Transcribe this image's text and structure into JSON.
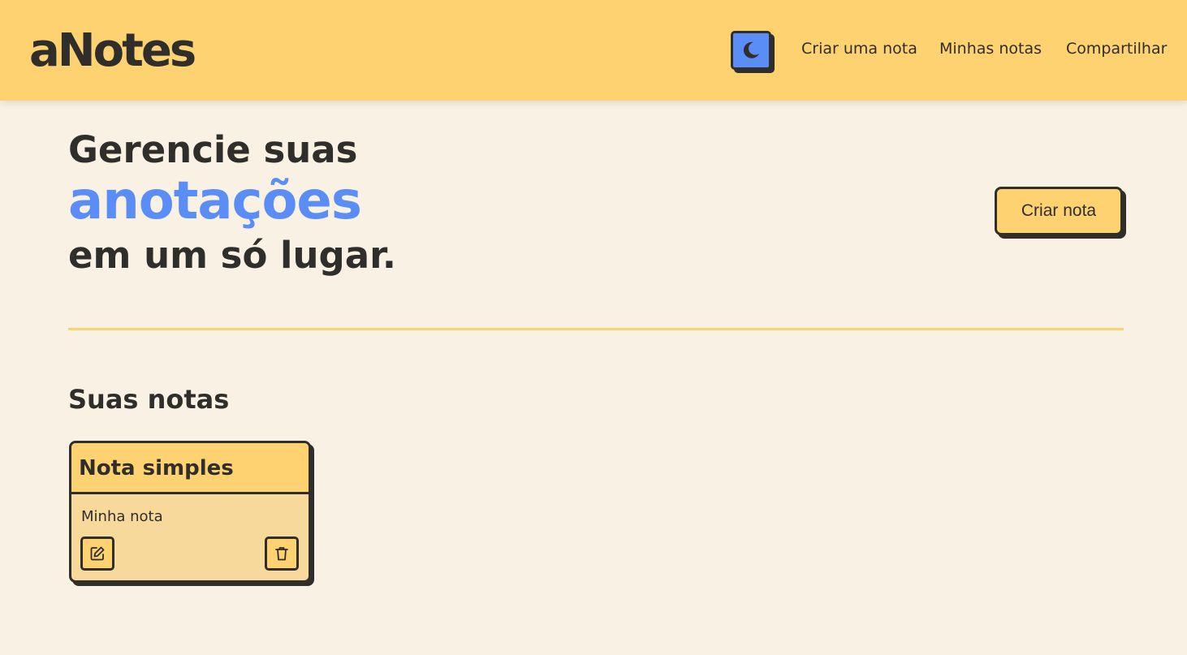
{
  "header": {
    "logo": "aNotes",
    "theme_toggle_icon": "moon-icon",
    "nav": [
      {
        "label": "Criar uma nota"
      },
      {
        "label": "Minhas notas"
      },
      {
        "label": "Compartilhar"
      }
    ]
  },
  "hero": {
    "line1": "Gerencie suas",
    "highlight": "anotações",
    "line3": "em um só lugar.",
    "cta_label": "Criar nota"
  },
  "notes_section": {
    "title": "Suas notas",
    "notes": [
      {
        "title": "Nota simples",
        "body": "Minha nota",
        "edit_icon": "edit-icon",
        "delete_icon": "trash-icon"
      }
    ]
  },
  "colors": {
    "background": "#f9f2e4",
    "header": "#ffd271",
    "accent_blue": "#5b8df6",
    "text": "#2f2e2b",
    "note_body": "#f7d99c"
  }
}
